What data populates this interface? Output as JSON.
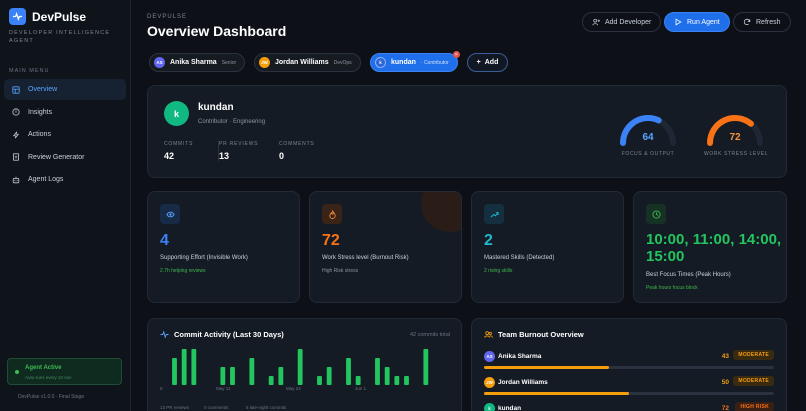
{
  "sidebar": {
    "brand": "DevPulse",
    "brand_sub": "DEVELOPER INTELLIGENCE AGENT",
    "menu_title": "MAIN MENU",
    "items": [
      {
        "label": "Overview",
        "icon": "grid-icon"
      },
      {
        "label": "Insights",
        "icon": "lightbulb-icon"
      },
      {
        "label": "Actions",
        "icon": "lightning-icon"
      },
      {
        "label": "Review Generator",
        "icon": "document-icon"
      },
      {
        "label": "Agent Logs",
        "icon": "robot-icon"
      }
    ],
    "agent_status": "Agent Active",
    "agent_sub": "Auto-runs every 10 min",
    "version": "DevPulse v1.0.0 · Final Stage"
  },
  "header": {
    "eyebrow": "DEVPULSE",
    "title": "Overview Dashboard",
    "add_developer": "Add Developer",
    "run_agent": "Run Agent",
    "refresh": "Refresh"
  },
  "developers": [
    {
      "initials": "AS",
      "name": "Anika Sharma",
      "role": "Senior",
      "color": "#6366f1"
    },
    {
      "initials": "JW",
      "name": "Jordan Williams",
      "role": "DevOps",
      "color": "#f59e0b"
    },
    {
      "initials": "k",
      "name": "kundan",
      "role": "· Contributor",
      "color": "#3b82f6"
    }
  ],
  "add_label": "Add",
  "profile": {
    "initial": "k",
    "name": "kundan",
    "subtitle": "Contributor · Engineering",
    "stats": [
      {
        "label": "COMMITS",
        "value": "42"
      },
      {
        "label": "PR REVIEWS",
        "value": "13"
      },
      {
        "label": "COMMENTS",
        "value": "0"
      }
    ],
    "gauges": [
      {
        "value": "64",
        "label": "FOCUS & OUTPUT",
        "color": "#3b82f6",
        "fraction": 0.64
      },
      {
        "value": "72",
        "label": "WORK STRESS LEVEL",
        "color": "#f97316",
        "fraction": 0.72
      }
    ]
  },
  "metrics": [
    {
      "value": "4",
      "title": "Supporting Effort (Invisible Work)",
      "sub": "2.7h helping reviews",
      "color": "#3b82f6",
      "sub_color": "#3fb950",
      "icon": "eye-icon"
    },
    {
      "value": "72",
      "title": "Work Stress level (Burnout Risk)",
      "sub": "High Risk stress",
      "color": "#f97316",
      "sub_color": "#8b949e",
      "icon": "flame-icon"
    },
    {
      "value": "2",
      "title": "Mastered Skills (Detected)",
      "sub": "2 rising skills",
      "color": "#22b8cf",
      "sub_color": "#3fb950",
      "icon": "trend-up-icon"
    },
    {
      "value": "10:00, 11:00, 14:00, 15:00",
      "title": "Best Focus Times (Peak Hours)",
      "sub": "Peak hours focus block",
      "color": "#22c55e",
      "sub_color": "#3fb950",
      "icon": "clock-icon"
    }
  ],
  "commit_activity": {
    "title": "Commit Activity (Last 30 Days)",
    "meta": "42 commits total",
    "footer": [
      "13 PR reviews",
      "0 comments",
      "5 late-night commits"
    ]
  },
  "burnout": {
    "title": "Team Burnout Overview",
    "rows": [
      {
        "initials": "AS",
        "name": "Anika Sharma",
        "score": "43",
        "fraction": 0.43,
        "badge": "MODERATE",
        "color": "#f59e0b",
        "avatar": "#6366f1"
      },
      {
        "initials": "JW",
        "name": "Jordan Williams",
        "score": "50",
        "fraction": 0.5,
        "badge": "MODERATE",
        "color": "#f59e0b",
        "avatar": "#f59e0b"
      },
      {
        "initials": "k",
        "name": "kundan",
        "score": "72",
        "fraction": 0.72,
        "badge": "HIGH RISK",
        "color": "#f97316",
        "avatar": "#10b981"
      }
    ]
  },
  "chart_data": {
    "type": "bar",
    "title": "Commit Activity (Last 30 Days)",
    "x_ticks": [
      "0",
      "May 11",
      "May 24",
      "Jun 1"
    ],
    "values": [
      0,
      3,
      4,
      4,
      0,
      0,
      2,
      2,
      0,
      3,
      0,
      1,
      2,
      0,
      4,
      0,
      1,
      2,
      0,
      3,
      1,
      0,
      3,
      2,
      1,
      1,
      0,
      4,
      0,
      0
    ],
    "color": "#22c55e"
  }
}
